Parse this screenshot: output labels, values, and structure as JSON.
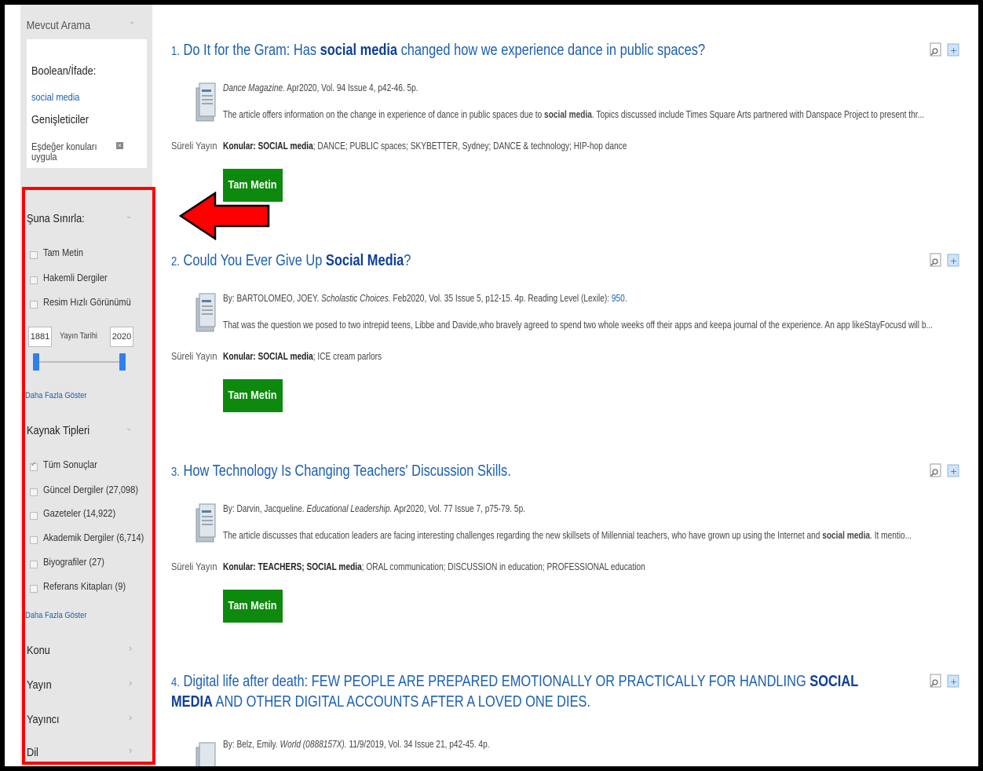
{
  "sidebar": {
    "current_search_heading": "Mevcut Arama",
    "boolean_label": "Boolean/İfade:",
    "query": "social media",
    "expanders_label": "Genişleticiler",
    "apply_equivalent_line1": "Eşdeğer konuları",
    "apply_equivalent_line2": "uygula",
    "limit_heading": "Şuna Sınırla:",
    "limits": [
      "Tam Metin",
      "Hakemli Dergiler",
      "Resim Hızlı Görünümü"
    ],
    "date_from": "1881",
    "date_label": "Yayın Tarihi",
    "date_to": "2020",
    "show_more_1": "Daha Fazla Göster",
    "source_types_heading": "Kaynak Tipleri",
    "source_types": [
      "Tüm Sonuçlar",
      "Güncel Dergiler (27,098)",
      "Gazeteler (14,922)",
      "Akademik Dergiler (6,714)",
      "Biyografiler (27)",
      "Referans Kitapları (9)"
    ],
    "show_more_2": "Daha Fazla Göster",
    "facets": [
      "Konu",
      "Yayın",
      "Yayıncı",
      "Dil"
    ]
  },
  "results": [
    {
      "num": "1.",
      "title_pre": "Do It for the Gram: Has ",
      "title_bold": "social media",
      "title_post": " changed how we experience dance in public spaces?",
      "meta_italic": "Dance Magazine.",
      "meta_rest": " Apr2020, Vol. 94 Issue 4, p42-46. 5p.",
      "abstract_pre": "The article offers information on the change in experience of dance in public spaces due to ",
      "abstract_bold": "social media",
      "abstract_post": ". Topics discussed include Times Square Arts partnered with Danspace Project to present thr...",
      "type": "Süreli Yayın",
      "subjects_label": "Konular:",
      "subjects_bold": "SOCIAL media",
      "subjects_rest": "; DANCE; PUBLIC spaces; SKYBETTER, Sydney; DANCE & technology; HIP-hop dance",
      "fulltext": "Tam Metin"
    },
    {
      "num": "2.",
      "title_pre": "Could You Ever Give Up ",
      "title_bold": "Social Media",
      "title_post": "?",
      "meta_pre": "By: BARTOLOMEO, JOEY. ",
      "meta_italic": "Scholastic Choices.",
      "meta_rest": " Feb2020, Vol. 35 Issue 5, p12-15. 4p. Reading Level (Lexile): ",
      "meta_lexile": "950",
      "meta_end": ".",
      "abstract": "That was the question we posed to two intrepid teens, Libbe and Davide,who bravely agreed to spend two whole weeks off their apps and keepa journal of the experience. An app likeStayFocusd will b...",
      "type": "Süreli Yayın",
      "subjects_label": "Konular:",
      "subjects_bold": "SOCIAL media",
      "subjects_rest": "; ICE cream parlors",
      "fulltext": "Tam Metin"
    },
    {
      "num": "3.",
      "title": "How Technology Is Changing Teachers' Discussion Skills.",
      "meta_pre": "By: Darvin, Jacqueline. ",
      "meta_italic": "Educational Leadership.",
      "meta_rest": " Apr2020, Vol. 77 Issue 7, p75-79. 5p.",
      "abstract_pre": "The article discusses that education leaders are facing interesting challenges regarding the new skillsets of Millennial teachers, who have grown up using the Internet and ",
      "abstract_bold": "social media",
      "abstract_post": ". It mentio...",
      "type": "Süreli Yayın",
      "subjects_label": "Konular:",
      "subjects_pre": " TEACHERS; ",
      "subjects_bold": "SOCIAL media",
      "subjects_rest": "; ORAL communication; DISCUSSION in education; PROFESSIONAL education",
      "fulltext": "Tam Metin"
    },
    {
      "num": "4.",
      "title_pre": "Digital life after death: FEW PEOPLE ARE PREPARED EMOTIONALLY OR PRACTICALLY FOR HANDLING ",
      "title_bold": "SOCIAL MEDIA",
      "title_post": " AND OTHER DIGITAL ACCOUNTS AFTER A LOVED ONE DIES.",
      "meta_pre": "By: Belz, Emily. ",
      "meta_italic": "World (0888157X).",
      "meta_rest": " 11/9/2019, Vol. 34 Issue 21, p42-45. 4p."
    }
  ],
  "colors": {
    "highlight_border": "#ff0000",
    "arrow_fill": "#ff0000",
    "link_blue": "#1a5fb4",
    "fulltext_green": "#0d8a0d",
    "sidebar_bg": "#e6e6e6"
  }
}
